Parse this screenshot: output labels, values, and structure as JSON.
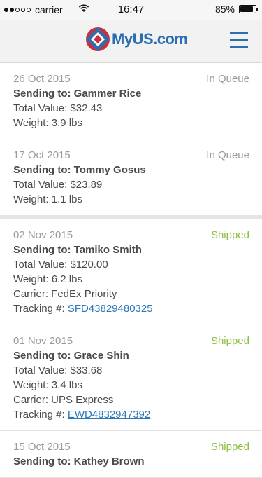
{
  "status_bar": {
    "carrier": "carrier",
    "time": "16:47",
    "battery": "85%",
    "battery_level": 0.85
  },
  "header": {
    "logo_text": "MyUS.com",
    "brand_color": "#2c6fb1",
    "menu_icon": "hamburger-menu-icon"
  },
  "colors": {
    "shipped": "#8cbf3f",
    "queue": "#9a9a9a",
    "link": "#2c78b8"
  },
  "packages": [
    {
      "date": "26 Oct 2015",
      "status": "In Queue",
      "sending_to": "Sending to: Gammer Rice",
      "total_value": "Total Value: $32.43",
      "weight": "Weight: 3.9 lbs"
    },
    {
      "date": "17 Oct 2015",
      "status": "In Queue",
      "sending_to": "Sending to: Tommy Gosus",
      "total_value": "Total Value: $23.89",
      "weight": "Weight: 1.1 lbs"
    },
    {
      "date": "02 Nov 2015",
      "status": "Shipped",
      "sending_to": "Sending to: Tamiko Smith",
      "total_value": "Total Value: $120.00",
      "weight": "Weight: 6.2 lbs",
      "carrier": "Carrier: FedEx Priority",
      "tracking_label": "Tracking #: ",
      "tracking_number": "SFD43829480325"
    },
    {
      "date": "01 Nov 2015",
      "status": "Shipped",
      "sending_to": "Sending to: Grace Shin",
      "total_value": "Total Value: $33.68",
      "weight": "Weight: 3.4 lbs",
      "carrier": "Carrier: UPS Express",
      "tracking_label": "Tracking #: ",
      "tracking_number": "EWD4832947392"
    },
    {
      "date": "15 Oct 2015",
      "status": "Shipped",
      "sending_to": "Sending to: Kathey Brown"
    }
  ]
}
